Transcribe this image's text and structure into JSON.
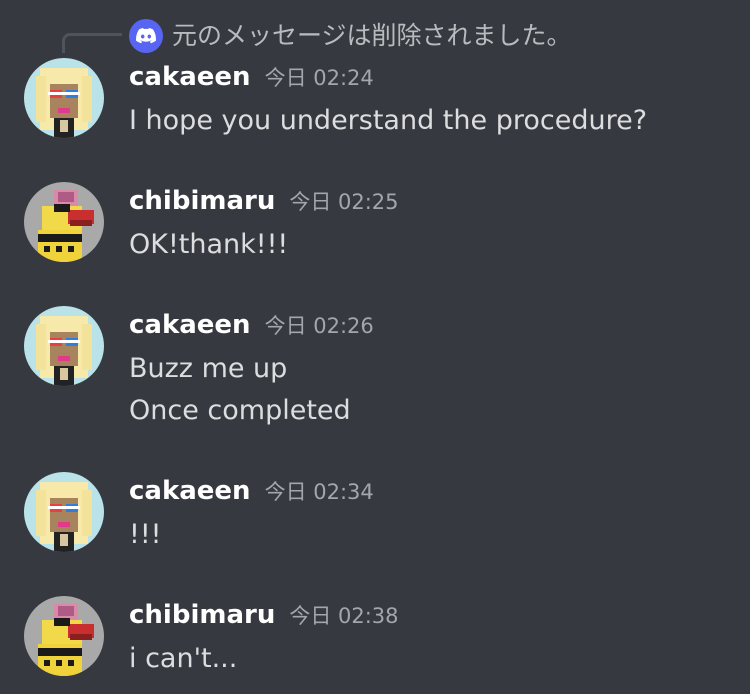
{
  "reply": {
    "text": "元のメッセージは削除されました。",
    "icon": "discord-logo-icon"
  },
  "colors": {
    "background": "#36393f",
    "username": "#ffffff",
    "timestamp": "#a3a6aa",
    "message_text": "#dcddde",
    "discord_blurple": "#5865f2"
  },
  "messages": [
    {
      "author": "cakaeen",
      "timestamp": "今日 02:24",
      "avatar": "cakaeen-avatar",
      "lines": [
        "I hope you understand the procedure?"
      ]
    },
    {
      "author": "chibimaru",
      "timestamp": "今日 02:25",
      "avatar": "chibimaru-avatar",
      "lines": [
        "OK!thank!!!"
      ]
    },
    {
      "author": "cakaeen",
      "timestamp": "今日 02:26",
      "avatar": "cakaeen-avatar",
      "lines": [
        "Buzz me up",
        "Once completed"
      ]
    },
    {
      "author": "cakaeen",
      "timestamp": "今日 02:34",
      "avatar": "cakaeen-avatar",
      "lines": [
        "!!!"
      ]
    },
    {
      "author": "chibimaru",
      "timestamp": "今日 02:38",
      "avatar": "chibimaru-avatar",
      "lines": [
        "i can't..."
      ]
    }
  ]
}
